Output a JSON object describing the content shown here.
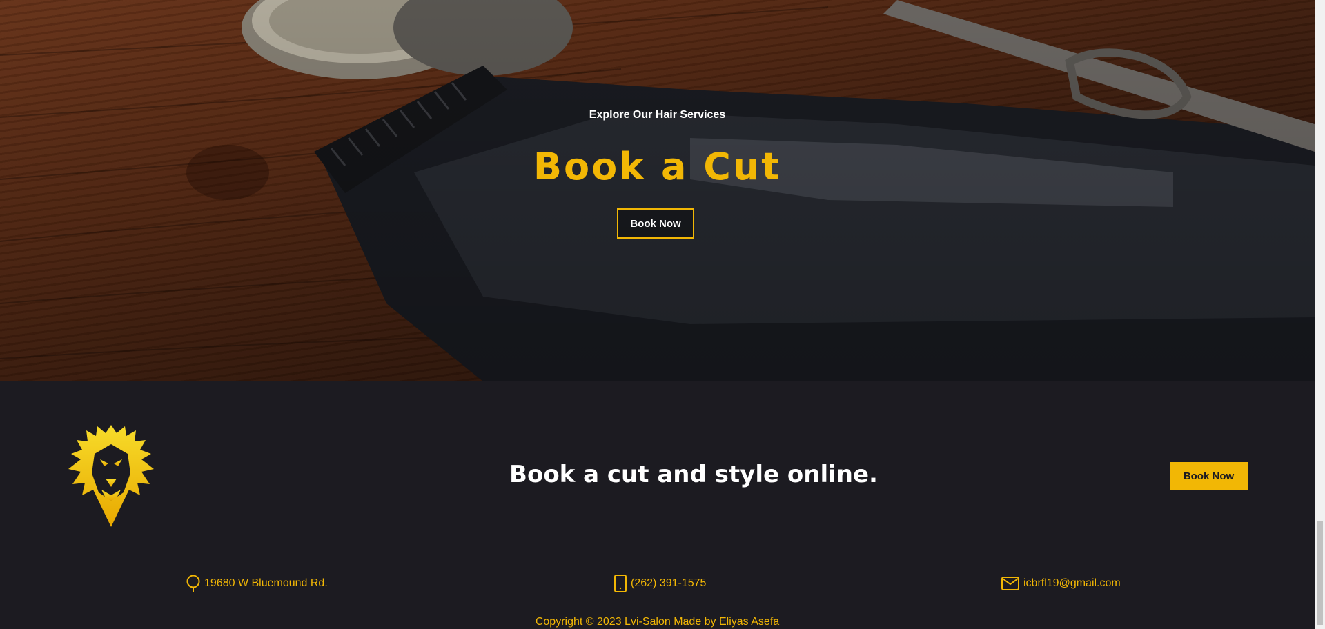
{
  "hero": {
    "subtitle": "Explore Our Hair Services",
    "title": "Book a Cut",
    "button_label": "Book Now"
  },
  "footer": {
    "cta_text": "Book a cut and style online.",
    "button_label": "Book Now",
    "contacts": {
      "address": "19680 W Bluemound Rd.",
      "phone": "(262) 391-1575",
      "email": "icbrfl19@gmail.com"
    },
    "copyright": "Copyright © 2023 Lvi-Salon Made by Eliyas Asefa"
  },
  "icons": {
    "logo": "lion-logo-icon",
    "address": "map-pin-icon",
    "phone": "phone-icon",
    "email": "mail-icon"
  },
  "colors": {
    "accent": "#f2b705",
    "footer_bg": "#1c1b21",
    "text_light": "#ffffff"
  }
}
